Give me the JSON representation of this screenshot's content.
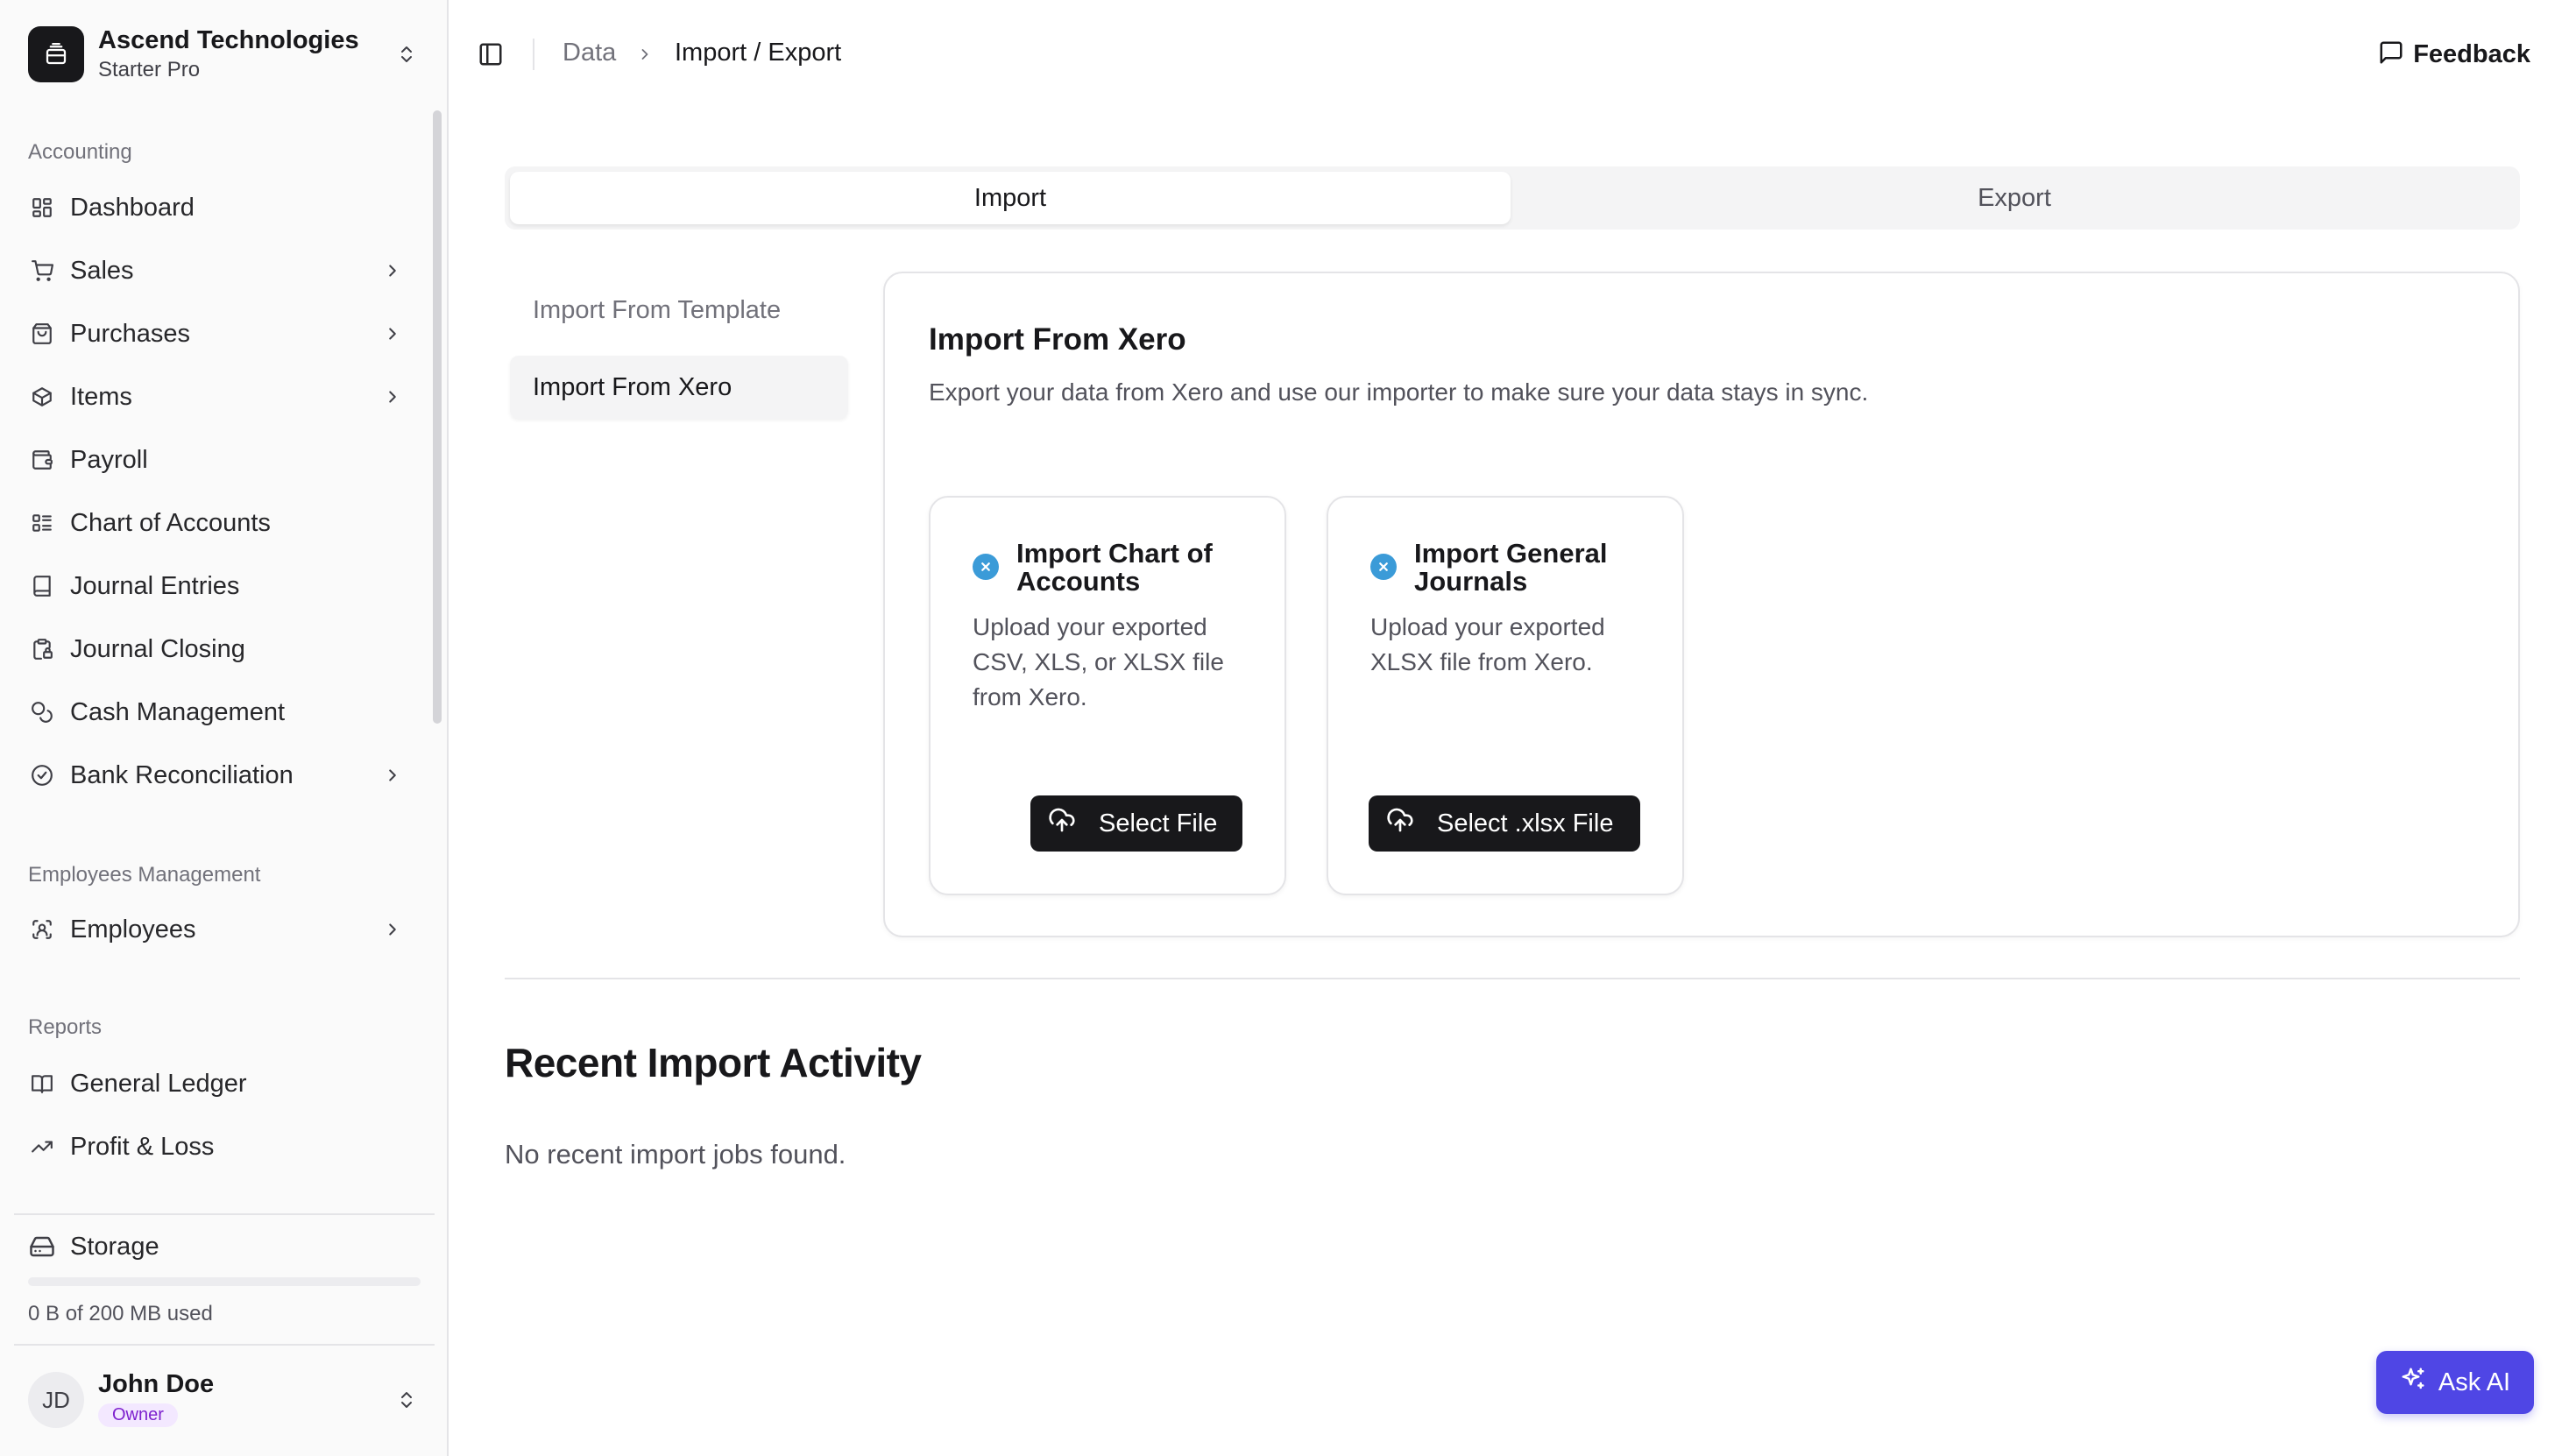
{
  "org": {
    "name": "Ascend Technologies",
    "plan": "Starter Pro"
  },
  "sidebar": {
    "accounting_label": "Accounting",
    "accounting_items": [
      {
        "label": "Dashboard",
        "icon": "dashboard-icon"
      },
      {
        "label": "Sales",
        "icon": "cart-icon"
      },
      {
        "label": "Purchases",
        "icon": "shopping-bag-icon"
      },
      {
        "label": "Items",
        "icon": "package-icon"
      },
      {
        "label": "Payroll",
        "icon": "wallet-icon"
      },
      {
        "label": "Chart of Accounts",
        "icon": "list-icon"
      },
      {
        "label": "Journal Entries",
        "icon": "book-icon"
      },
      {
        "label": "Journal Closing",
        "icon": "clipboard-lock-icon"
      },
      {
        "label": "Cash Management",
        "icon": "coins-icon"
      },
      {
        "label": "Bank Reconciliation",
        "icon": "check-circle-icon"
      }
    ],
    "employees_label": "Employees Management",
    "employees_items": [
      {
        "label": "Employees",
        "icon": "scan-user-icon"
      }
    ],
    "reports_label": "Reports",
    "reports_items": [
      {
        "label": "General Ledger",
        "icon": "ledger-icon"
      },
      {
        "label": "Profit & Loss",
        "icon": "trending-up-icon"
      }
    ],
    "storage": {
      "label": "Storage",
      "used_text": "0 B of 200 MB used",
      "used_fraction": 0
    }
  },
  "user": {
    "initials": "JD",
    "name": "John Doe",
    "role": "Owner"
  },
  "header": {
    "breadcrumb": [
      "Data",
      "Import / Export"
    ],
    "feedback_label": "Feedback"
  },
  "tabs": {
    "import": "Import",
    "export": "Export",
    "active": "import"
  },
  "subnav": {
    "template": "Import From Template",
    "xero": "Import From Xero",
    "active": "xero"
  },
  "panel": {
    "title": "Import From Xero",
    "description": "Export your data from Xero and use our importer to make sure your data stays in sync.",
    "cards": [
      {
        "title": "Import Chart of Accounts",
        "description": "Upload your exported CSV, XLS, or XLSX file from Xero.",
        "button": "Select File"
      },
      {
        "title": "Import General Journals",
        "description": "Upload your exported XLSX file from Xero.",
        "button": "Select .xlsx File"
      }
    ]
  },
  "recent": {
    "title": "Recent Import Activity",
    "empty": "No recent import jobs found."
  },
  "ask_ai": {
    "label": "Ask AI"
  },
  "colors": {
    "primary": "#18181b",
    "accent": "#4f46e5",
    "xero": "#3b9bd8",
    "owner_badge": "#7e22ce"
  }
}
